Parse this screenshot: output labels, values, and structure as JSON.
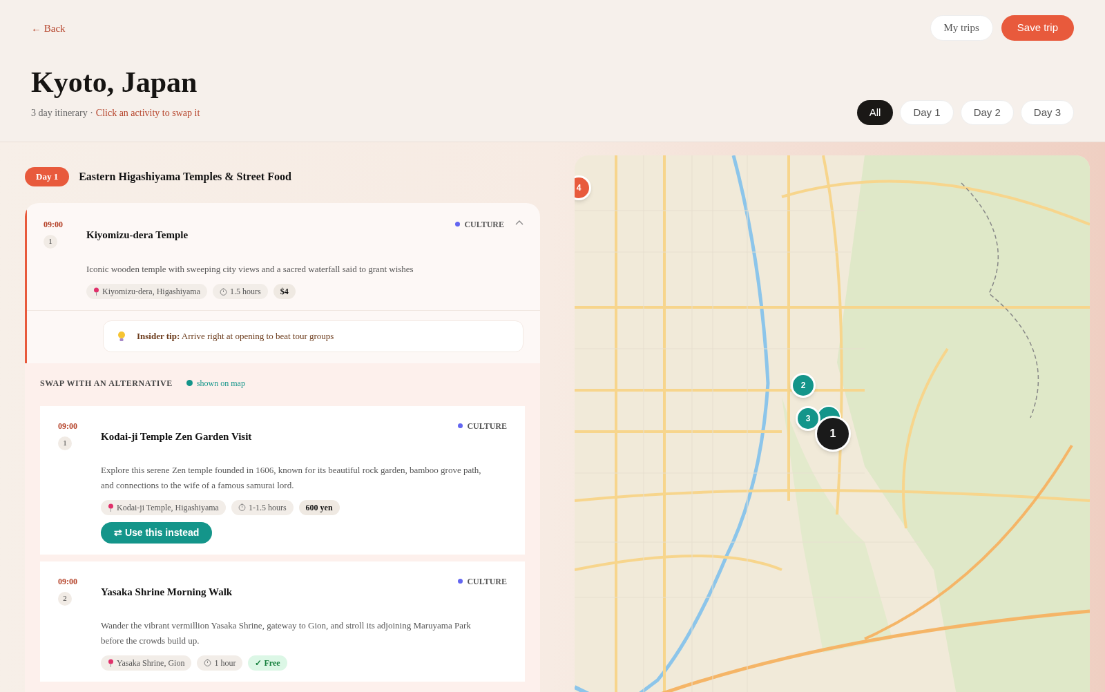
{
  "header": {
    "back": "← Back",
    "title": "Kyoto, Japan",
    "subtitle_prefix": "3 day itinerary ·",
    "subtitle_hint": "Click an activity to swap it",
    "actions": [
      {
        "label": "My trips",
        "kind": "secondary"
      },
      {
        "label": "Save trip",
        "kind": "primary"
      }
    ],
    "day_tabs": [
      {
        "label": "All",
        "selected": true
      },
      {
        "label": "Day 1",
        "selected": false
      },
      {
        "label": "Day 2",
        "selected": false
      },
      {
        "label": "Day 3",
        "selected": false
      }
    ]
  },
  "day": {
    "badge": "Day 1",
    "title": "Eastern Higashiyama Temples & Street Food"
  },
  "activity": {
    "time": "09:00",
    "number": "1",
    "name": "Kiyomizu-dera Temple",
    "category": "CULTURE",
    "expanded": true,
    "selected": true,
    "description": "Iconic wooden temple with sweeping city views and a sacred waterfall said to grant wishes",
    "tags": [
      {
        "kind": "location",
        "text": "Kiyomizu-dera, Higashiyama"
      },
      {
        "kind": "duration",
        "text": "1.5 hours"
      },
      {
        "kind": "price",
        "text": "$4"
      }
    ],
    "tip": "**Insider tip:** Arrive right at opening to beat tour groups"
  },
  "swap": {
    "title": "SWAP WITH AN ALTERNATIVE",
    "legend": "shown on map",
    "alternatives": [
      {
        "time": "09:00",
        "number": "1",
        "name": "Kodai-ji Temple Zen Garden Visit",
        "category": "CULTURE",
        "description": "Explore this serene Zen temple founded in 1606, known for its beautiful rock garden, bamboo grove path, and connections to the wife of a famous samurai lord.",
        "tags": [
          {
            "kind": "location",
            "text": "Kodai-ji Temple, Higashiyama"
          },
          {
            "kind": "duration",
            "text": "1-1.5 hours"
          },
          {
            "kind": "price",
            "text": "600 yen"
          }
        ],
        "action": "⇄ Use this instead"
      },
      {
        "time": "09:00",
        "number": "2",
        "name": "Yasaka Shrine Morning Walk",
        "category": "CULTURE",
        "description": "Wander the vibrant vermillion Yasaka Shrine, gateway to Gion, and stroll its adjoining Maruyama Park before the crowds build up.",
        "tags": [
          {
            "kind": "location",
            "text": "Yasaka Shrine, Gion"
          },
          {
            "kind": "duration",
            "text": "1 hour"
          },
          {
            "kind": "free",
            "text": "✓ Free"
          }
        ]
      }
    ]
  },
  "map": {
    "markers": [
      {
        "label": "4",
        "color": "#e85a3c",
        "kind": "stop"
      },
      {
        "label": "2",
        "color": "#14958a",
        "kind": "alternative"
      },
      {
        "label": "3",
        "color": "#14958a",
        "kind": "alternative"
      },
      {
        "label": "1",
        "color": "#1a1a1a",
        "kind": "current"
      }
    ]
  }
}
